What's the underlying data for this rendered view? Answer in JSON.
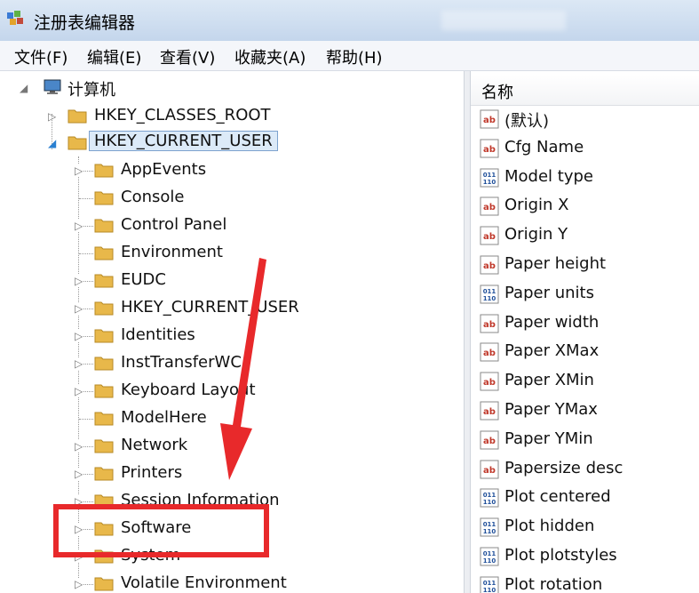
{
  "window": {
    "title": "注册表编辑器"
  },
  "menu": [
    {
      "label": "文件(F)"
    },
    {
      "label": "编辑(E)"
    },
    {
      "label": "查看(V)"
    },
    {
      "label": "收藏夹(A)"
    },
    {
      "label": "帮助(H)"
    }
  ],
  "tree": {
    "root": "计算机",
    "top_keys": [
      "HKEY_CLASSES_ROOT",
      "HKEY_CURRENT_USER"
    ],
    "children": [
      "AppEvents",
      "Console",
      "Control Panel",
      "Environment",
      "EUDC",
      "HKEY_CURRENT_USER",
      "Identities",
      "InstTransferWC",
      "Keyboard Layout",
      "ModelHere",
      "Network",
      "Printers",
      "Session Information",
      "Software",
      "System",
      "Volatile Environment"
    ]
  },
  "list": {
    "column": "名称",
    "values": [
      {
        "name": "(默认)",
        "type": "string"
      },
      {
        "name": "Cfg Name",
        "type": "string"
      },
      {
        "name": "Model type",
        "type": "binary"
      },
      {
        "name": "Origin X",
        "type": "string"
      },
      {
        "name": "Origin Y",
        "type": "string"
      },
      {
        "name": "Paper height",
        "type": "string"
      },
      {
        "name": "Paper units",
        "type": "binary"
      },
      {
        "name": "Paper width",
        "type": "string"
      },
      {
        "name": "Paper XMax",
        "type": "string"
      },
      {
        "name": "Paper XMin",
        "type": "string"
      },
      {
        "name": "Paper YMax",
        "type": "string"
      },
      {
        "name": "Paper YMin",
        "type": "string"
      },
      {
        "name": "Papersize desc",
        "type": "string"
      },
      {
        "name": "Plot centered",
        "type": "binary"
      },
      {
        "name": "Plot hidden",
        "type": "binary"
      },
      {
        "name": "Plot plotstyles",
        "type": "binary"
      },
      {
        "name": "Plot rotation",
        "type": "binary"
      }
    ]
  },
  "colors": {
    "highlight": "#e8292b",
    "selection": "#dceaf8",
    "folder": "#e8b84a"
  }
}
